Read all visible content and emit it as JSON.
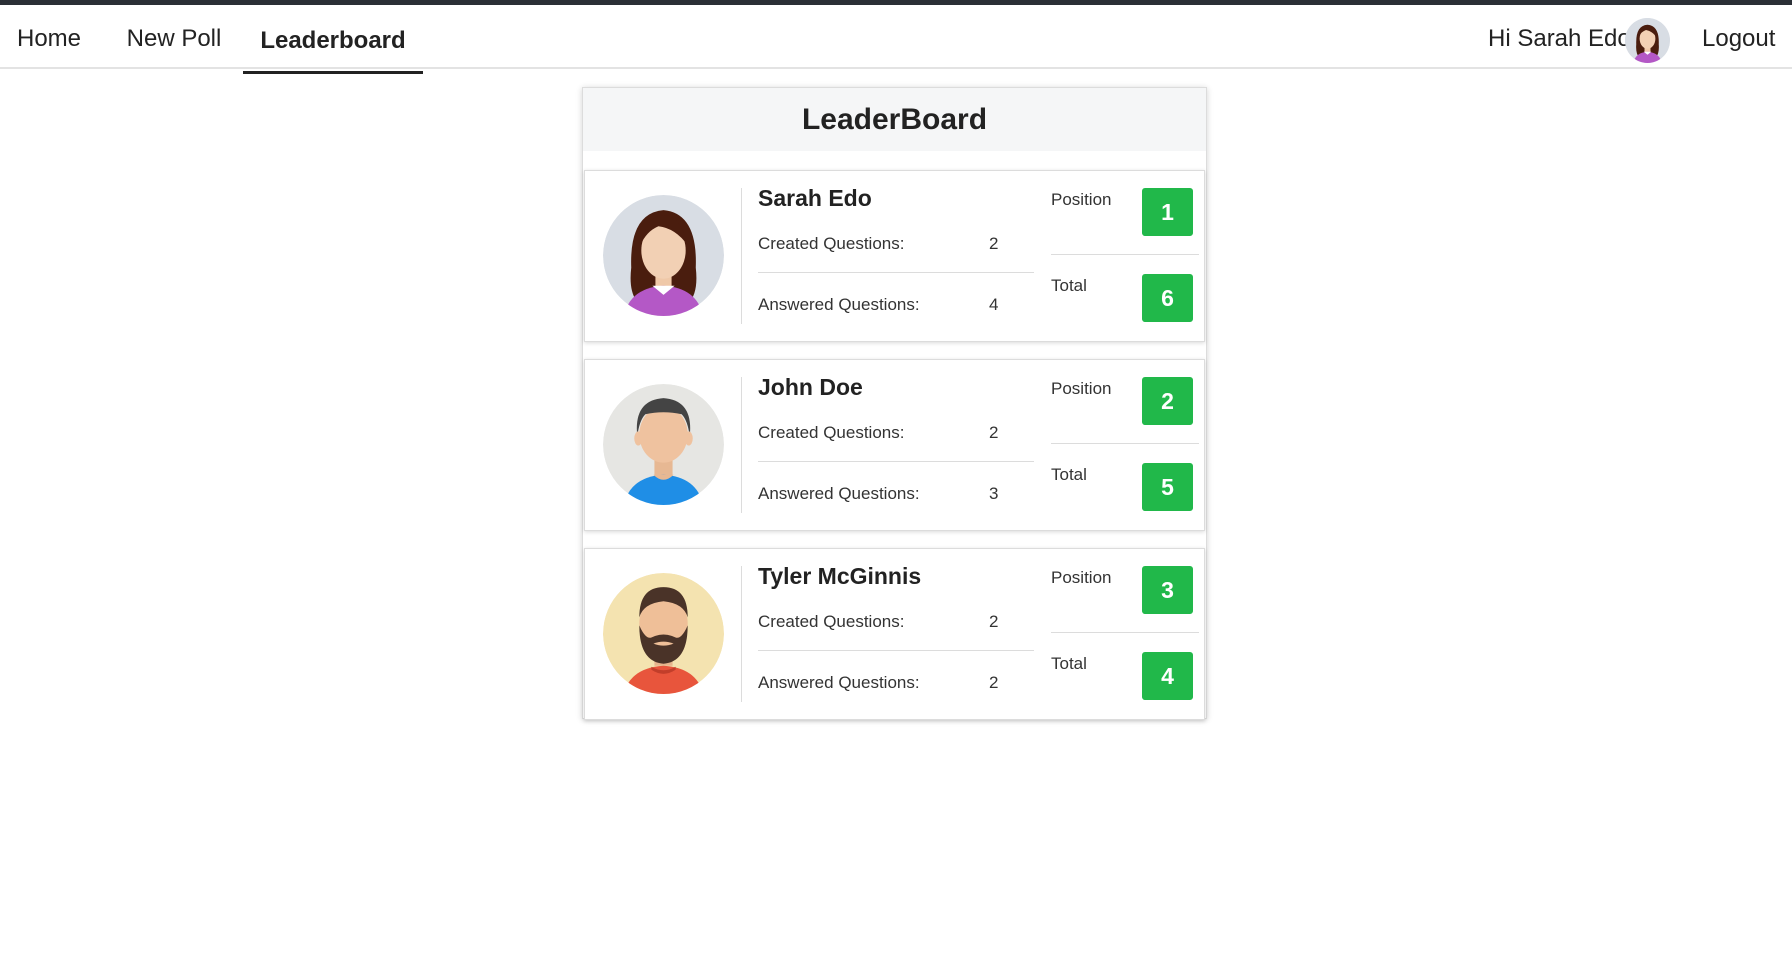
{
  "nav": {
    "home": "Home",
    "new_poll": "New Poll",
    "leaderboard": "Leaderboard",
    "greeting": "Hi Sarah Edo",
    "logout": "Logout"
  },
  "board": {
    "title": "LeaderBoard",
    "position_label": "Position",
    "total_label": "Total",
    "created_label": "Created Questions:",
    "answered_label": "Answered Questions:",
    "users": [
      {
        "name": "Sarah Edo",
        "created": "2",
        "answered": "4",
        "position": "1",
        "total": "6",
        "avatar": "woman-avatar-icon"
      },
      {
        "name": "John Doe",
        "created": "2",
        "answered": "3",
        "position": "2",
        "total": "5",
        "avatar": "man-avatar-icon"
      },
      {
        "name": "Tyler McGinnis",
        "created": "2",
        "answered": "2",
        "position": "3",
        "total": "4",
        "avatar": "bearded-man-avatar-icon"
      }
    ]
  },
  "colors": {
    "badge": "#21b84a",
    "topbar": "#2b2f36"
  }
}
